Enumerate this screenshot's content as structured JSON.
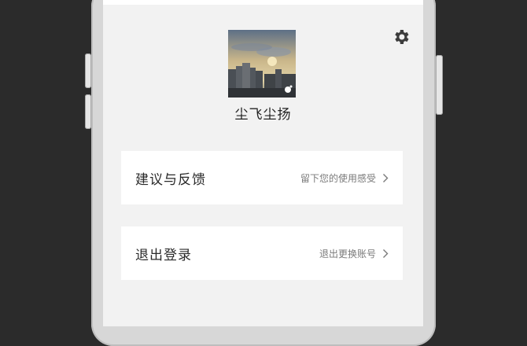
{
  "profile": {
    "username": "尘飞尘扬"
  },
  "settings": {
    "icon": "gear-icon"
  },
  "menu": [
    {
      "label": "建议与反馈",
      "hint": "留下您的使用感受",
      "icon": "chevron-right-icon"
    },
    {
      "label": "退出登录",
      "hint": "退出更换账号",
      "icon": "chevron-right-icon"
    }
  ],
  "colors": {
    "page_background": "#f2f2f2",
    "card_background": "#ffffff",
    "device_frame": "#d7d7d7",
    "outer_background": "#2b2b2b"
  }
}
